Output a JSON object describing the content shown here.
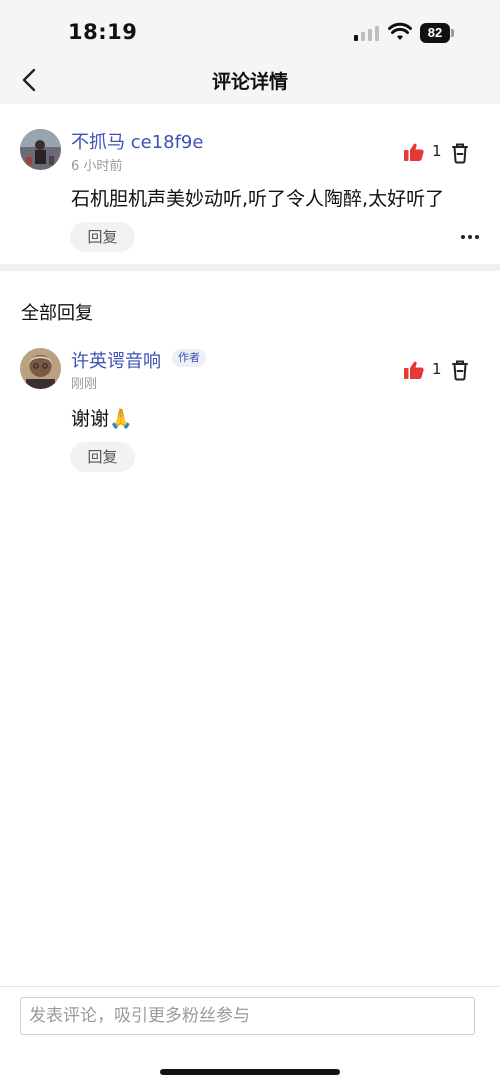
{
  "status": {
    "time": "18:19",
    "battery": "82"
  },
  "nav": {
    "title": "评论详情"
  },
  "comment": {
    "username": "不抓马 ce18f9e",
    "time": "6 小时前",
    "text": "石机胆机声美妙动听,听了令人陶醉,太好听了",
    "likes": "1",
    "reply_label": "回复"
  },
  "replies_section": {
    "title": "全部回复"
  },
  "reply": {
    "username": "许英谔音响",
    "badge": "作者",
    "time": "刚刚",
    "text": "谢谢🙏",
    "likes": "1",
    "reply_label": "回复"
  },
  "input": {
    "placeholder": "发表评论，吸引更多粉丝参与"
  },
  "colors": {
    "link": "#3f51b5",
    "like": "#e53935"
  },
  "icons": [
    "back-icon",
    "thumbs-up-icon",
    "trash-icon",
    "more-icon",
    "wifi-icon",
    "battery-icon"
  ]
}
